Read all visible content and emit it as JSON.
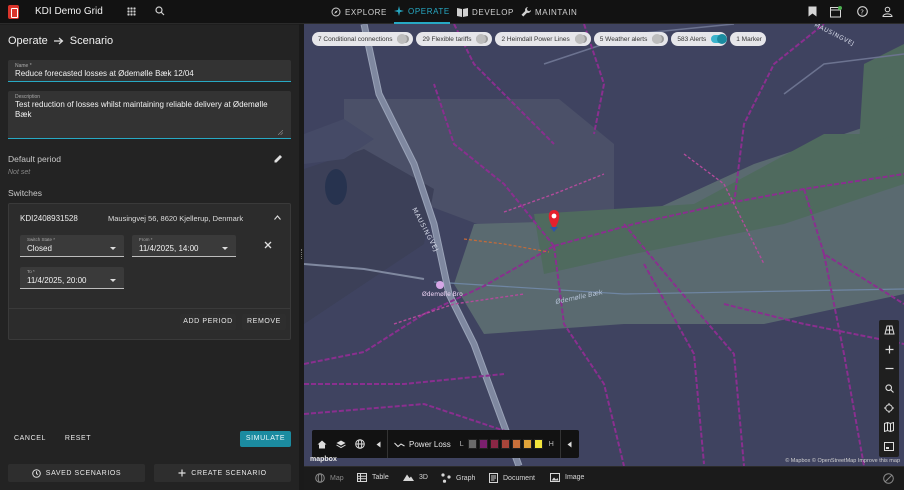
{
  "app": {
    "title": "KDI Demo Grid"
  },
  "nav": [
    {
      "label": "EXPLORE",
      "icon": "compass-icon",
      "active": false
    },
    {
      "label": "OPERATE",
      "icon": "sparkle-icon",
      "active": true
    },
    {
      "label": "DEVELOP",
      "icon": "book-icon",
      "active": false
    },
    {
      "label": "MAINTAIN",
      "icon": "wrench-icon",
      "active": false
    }
  ],
  "breadcrumb": {
    "parent": "Operate",
    "current": "Scenario"
  },
  "form": {
    "name_label": "Name *",
    "name_value": "Reduce forecasted losses at Ødemølle Bæk 12/04",
    "description_label": "Description",
    "description_value": "Test reduction of losses whilst maintaining reliable delivery at Ødemølle Bæk",
    "default_period_label": "Default period",
    "default_period_value": "Not set",
    "switches_label": "Switches"
  },
  "switch_card": {
    "id": "KDI2408931528",
    "address": "Mausingvej 56, 8620 Kjellerup, Denmark",
    "state_label": "Switch State *",
    "state_value": "Closed",
    "from_label": "From *",
    "from_value": "11/4/2025, 14:00",
    "to_label": "To *",
    "to_value": "11/4/2025, 20:00",
    "add_period": "ADD PERIOD",
    "remove": "REMOVE"
  },
  "actions": {
    "cancel": "CANCEL",
    "reset": "RESET",
    "simulate": "SIMULATE",
    "saved": "SAVED SCENARIOS",
    "create": "CREATE SCENARIO"
  },
  "chips": [
    {
      "label": "7 Conditional connections",
      "on": false
    },
    {
      "label": "29 Flexible tariffs",
      "on": false
    },
    {
      "label": "2 Heimdall Power Lines",
      "on": false
    },
    {
      "label": "5 Weather alerts",
      "on": false
    },
    {
      "label": "583 Alerts",
      "on": true
    },
    {
      "label": "1 Marker",
      "on": false
    }
  ],
  "map": {
    "road_label": "MAUSINGVEJ",
    "road_label_2": "MAUSINGVEJ",
    "stream_label": "Ødemølle Bæk",
    "poi_label": "Ødemølle Bro",
    "attribution": "© Mapbox © OpenStreetMap  Improve this map",
    "logo": "mapbox"
  },
  "legend": {
    "label": "Power Loss",
    "low": "L",
    "high": "H",
    "colors": [
      "#6b6b6b",
      "#7a1f6e",
      "#8a2745",
      "#a8453a",
      "#c9703a",
      "#e0a33a",
      "#f2e43c"
    ]
  },
  "views": [
    {
      "label": "Map",
      "icon": "globe-icon",
      "dim": true
    },
    {
      "label": "Table",
      "icon": "table-icon",
      "dim": false
    },
    {
      "label": "3D",
      "icon": "mountain-icon",
      "dim": false
    },
    {
      "label": "Graph",
      "icon": "graph-icon",
      "dim": false
    },
    {
      "label": "Document",
      "icon": "document-icon",
      "dim": false
    },
    {
      "label": "Image",
      "icon": "image-icon",
      "dim": false
    }
  ]
}
